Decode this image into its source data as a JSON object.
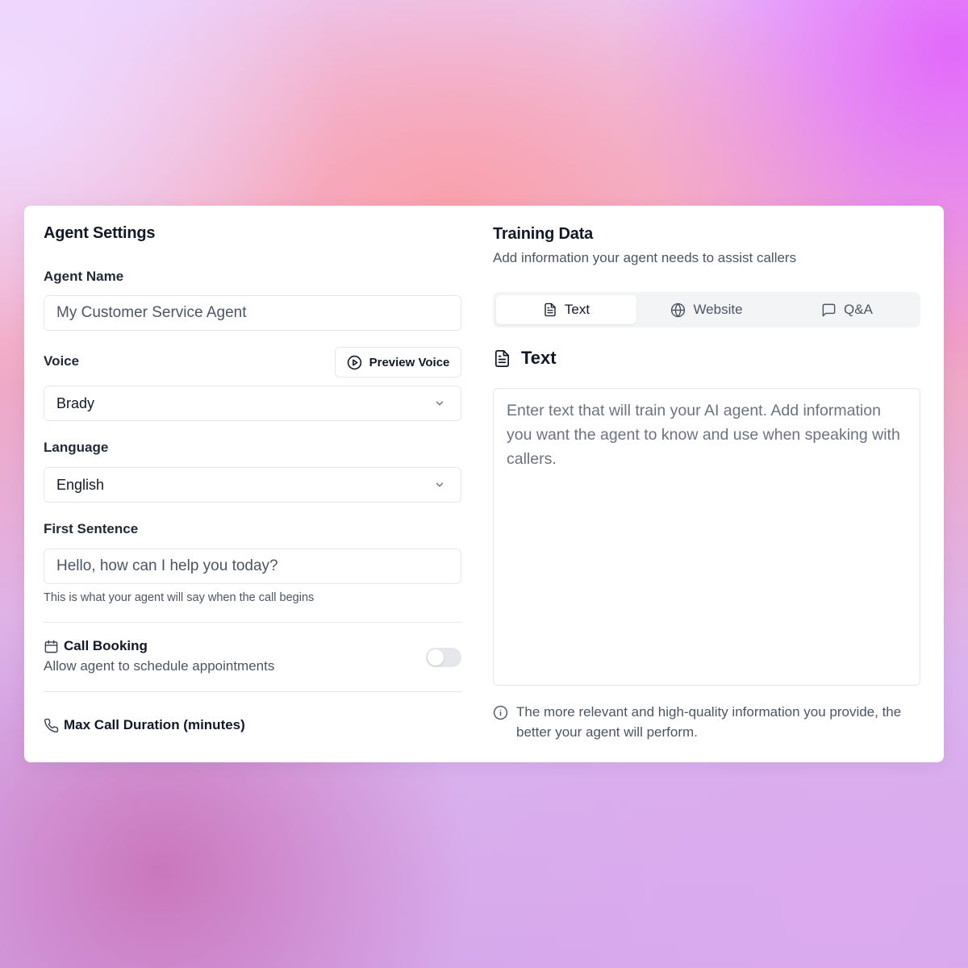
{
  "agent_settings": {
    "title": "Agent Settings",
    "agent_name": {
      "label": "Agent Name",
      "placeholder": "My Customer Service Agent"
    },
    "voice": {
      "label": "Voice",
      "preview_label": "Preview Voice",
      "selected": "Brady"
    },
    "language": {
      "label": "Language",
      "selected": "English"
    },
    "first_sentence": {
      "label": "First Sentence",
      "placeholder": "Hello, how can I help you today?",
      "hint": "This is what your agent will say when the call begins"
    },
    "call_booking": {
      "title": "Call Booking",
      "description": "Allow agent to schedule appointments",
      "enabled": false
    },
    "max_call_duration": {
      "title": "Max Call Duration (minutes)"
    }
  },
  "training_data": {
    "title": "Training Data",
    "subtitle": "Add information your agent needs to assist callers",
    "tabs": [
      {
        "label": "Text",
        "icon": "document-icon",
        "active": true
      },
      {
        "label": "Website",
        "icon": "globe-icon",
        "active": false
      },
      {
        "label": "Q&A",
        "icon": "chat-bubble-icon",
        "active": false
      }
    ],
    "content_title": "Text",
    "textarea_placeholder": "Enter text that will train your AI agent. Add information you want the agent to know and use when speaking with callers.",
    "info_text": "The more relevant and high-quality information you provide, the better your agent will perform."
  },
  "colors": {
    "border": "#e5e7eb",
    "muted_text": "#4b5563",
    "tab_bg": "#f3f4f6"
  }
}
